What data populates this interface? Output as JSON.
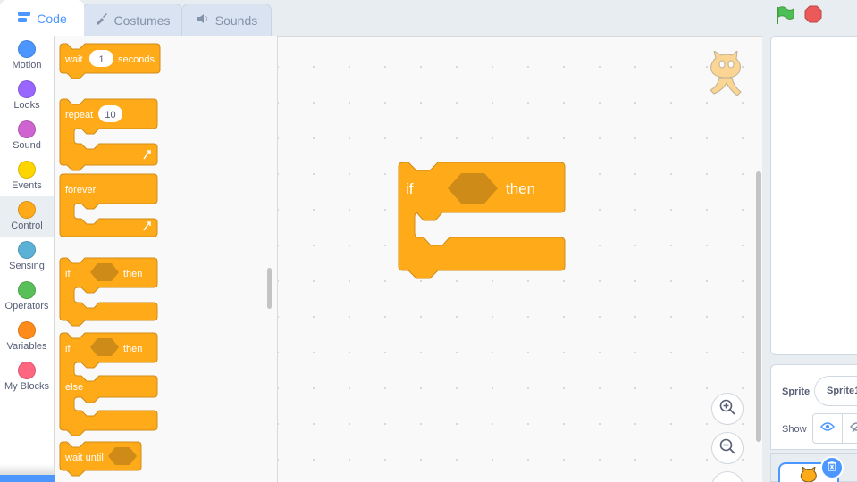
{
  "tabs": {
    "code": "Code",
    "costumes": "Costumes",
    "sounds": "Sounds"
  },
  "categories": [
    {
      "label": "Motion",
      "color": "#4c97ff"
    },
    {
      "label": "Looks",
      "color": "#9966ff"
    },
    {
      "label": "Sound",
      "color": "#cf63cf"
    },
    {
      "label": "Events",
      "color": "#ffd500"
    },
    {
      "label": "Control",
      "color": "#ffab19"
    },
    {
      "label": "Sensing",
      "color": "#5cb1d6"
    },
    {
      "label": "Operators",
      "color": "#59c059"
    },
    {
      "label": "Variables",
      "color": "#ff8c1a"
    },
    {
      "label": "My Blocks",
      "color": "#ff6680"
    }
  ],
  "selected_category": "Control",
  "palette": {
    "wait": {
      "label": "wait",
      "value": "1",
      "unit": "seconds"
    },
    "repeat": {
      "label": "repeat",
      "value": "10"
    },
    "forever": {
      "label": "forever"
    },
    "if_then": {
      "if": "if",
      "then": "then"
    },
    "if_else": {
      "if": "if",
      "then": "then",
      "else": "else"
    },
    "wait_until": {
      "label": "wait until"
    }
  },
  "workspace_block": {
    "if": "if",
    "then": "then"
  },
  "sprite": {
    "label": "Sprite",
    "name": "Sprite1",
    "show_label": "Show"
  },
  "colors": {
    "control": "#ffab19",
    "control_dark": "#cf8b17",
    "accent": "#4c97ff"
  },
  "icons": [
    "code-icon",
    "brush-icon",
    "speaker-icon",
    "green-flag-icon",
    "stop-icon",
    "zoom-in-icon",
    "zoom-out-icon",
    "eye-icon",
    "eye-slash-icon",
    "trash-icon",
    "cat-sprite-icon"
  ]
}
